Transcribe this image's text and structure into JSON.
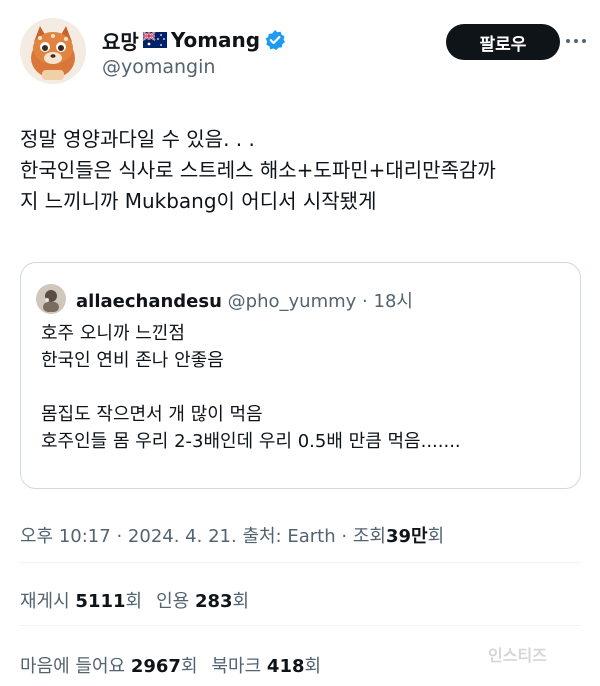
{
  "author": {
    "display_name": "요망",
    "display_name_en": "Yomang",
    "handle": "@yomangin",
    "flag_icon": "australia-flag-icon",
    "verified_icon": "verified-badge-icon",
    "verified_color": "#1d9bf0"
  },
  "actions": {
    "follow_label": "팔로우",
    "more_icon": "more-options-icon"
  },
  "tweet": {
    "lines": [
      "정말 영양과다일 수 있음. . .",
      "한국인들은 식사로 스트레스 해소+도파민+대리만족감까",
      "지 느끼니까 Mukbang이 어디서 시작됐게"
    ]
  },
  "quoted": {
    "name": "allaechandesu",
    "handle": "@pho_yummy",
    "separator": "·",
    "time": "18시",
    "lines": [
      "호주 오니까 느낀점",
      "한국인 연비 존나 안좋음",
      "",
      "몸집도 작으면서 개 많이 먹음",
      "호주인들 몸 우리 2-3배인데 우리 0.5배 만큼 먹음......."
    ]
  },
  "meta": {
    "time": "오후 10:17",
    "sep": "·",
    "date": "2024. 4. 21.",
    "source": "출처: Earth",
    "views_label": "조회",
    "views_num": "39만",
    "views_suffix": "회"
  },
  "stats_row1": {
    "retweet_label": "재게시",
    "retweet_num": "5111",
    "retweet_suffix": "회",
    "quote_label": "인용",
    "quote_num": "283",
    "quote_suffix": "회"
  },
  "stats_row2": {
    "like_label": "마음에 들어요",
    "like_num": "2967",
    "like_suffix": "회",
    "bookmark_label": "북마크",
    "bookmark_num": "418",
    "bookmark_suffix": "회"
  },
  "watermark": "인스티즈"
}
